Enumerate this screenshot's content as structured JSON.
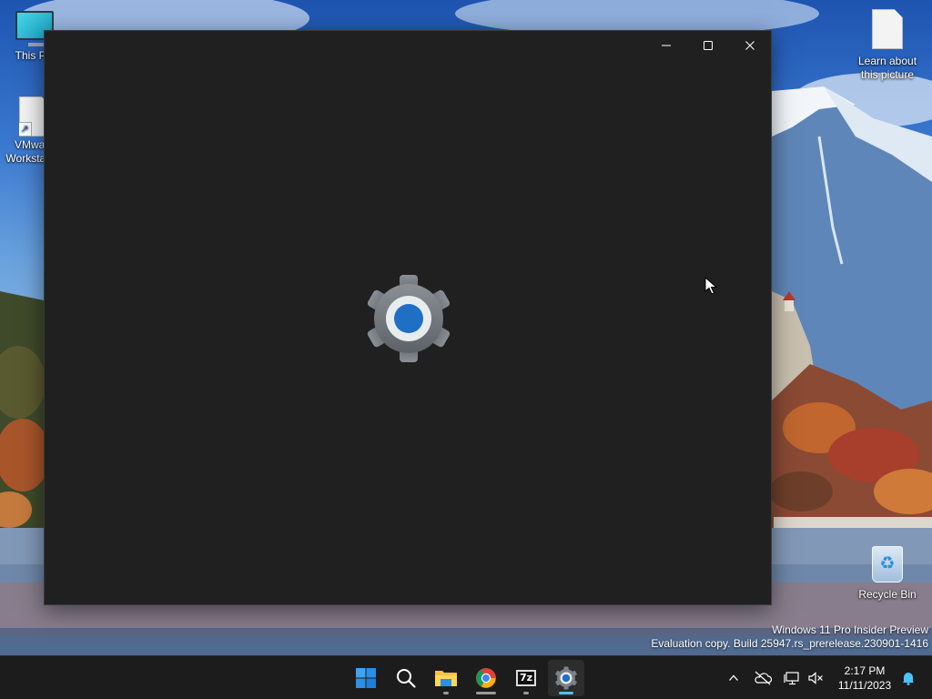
{
  "desktop": {
    "icons": [
      {
        "label": "This PC"
      },
      {
        "label": "VMware Workstation"
      },
      {
        "label": "Learn about this picture"
      },
      {
        "label": "Recycle Bin"
      }
    ],
    "watermark": {
      "line1": "Windows 11 Pro Insider Preview",
      "line2": "Evaluation copy. Build 25947.rs_prerelease.230901-1416"
    }
  },
  "window": {
    "app_icon": "settings-gear-icon",
    "background": "#202020",
    "controls": [
      "minimize-icon",
      "maximize-icon",
      "close-icon"
    ]
  },
  "taskbar": {
    "apps": [
      {
        "icon": "windows-start-icon"
      },
      {
        "icon": "search-icon"
      },
      {
        "icon": "file-explorer-icon",
        "running": true
      },
      {
        "icon": "chrome-icon",
        "running": true
      },
      {
        "icon": "7zip-icon",
        "text": "7z",
        "running": true
      },
      {
        "icon": "settings-gear-icon",
        "running": true,
        "active": true
      }
    ],
    "tray": [
      "chevron-up-icon",
      "onedrive-offline-icon",
      "network-icon",
      "volume-muted-icon",
      "notification-bell-icon"
    ],
    "clock": {
      "time": "2:17 PM",
      "date": "11/11/2023"
    }
  },
  "colors": {
    "accent": "#4cc2ff",
    "taskbar_bg": "#1c1c1c",
    "gear_gray": "#6e7479",
    "gear_blue": "#1f6fc5"
  }
}
